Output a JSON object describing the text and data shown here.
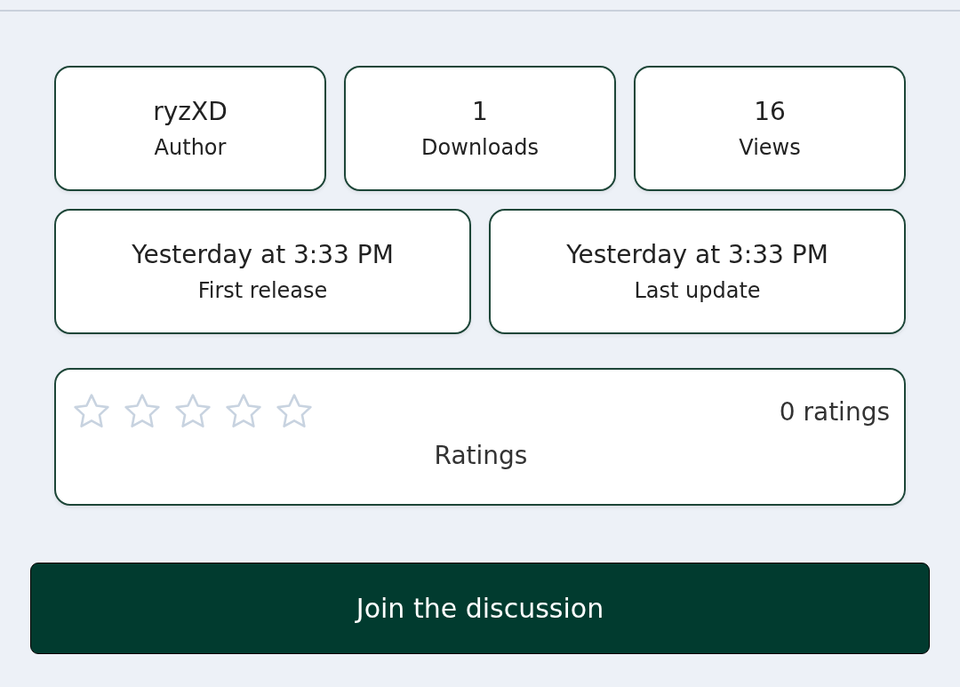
{
  "stats_top": [
    {
      "value": "ryzXD",
      "label": "Author"
    },
    {
      "value": "1",
      "label": "Downloads"
    },
    {
      "value": "16",
      "label": "Views"
    }
  ],
  "stats_dates": [
    {
      "value": "Yesterday at 3:33 PM",
      "label": "First release"
    },
    {
      "value": "Yesterday at 3:33 PM",
      "label": "Last update"
    }
  ],
  "rating": {
    "stars": 0,
    "count": "0 ratings",
    "label": "Ratings"
  },
  "button": "Join the discussion"
}
